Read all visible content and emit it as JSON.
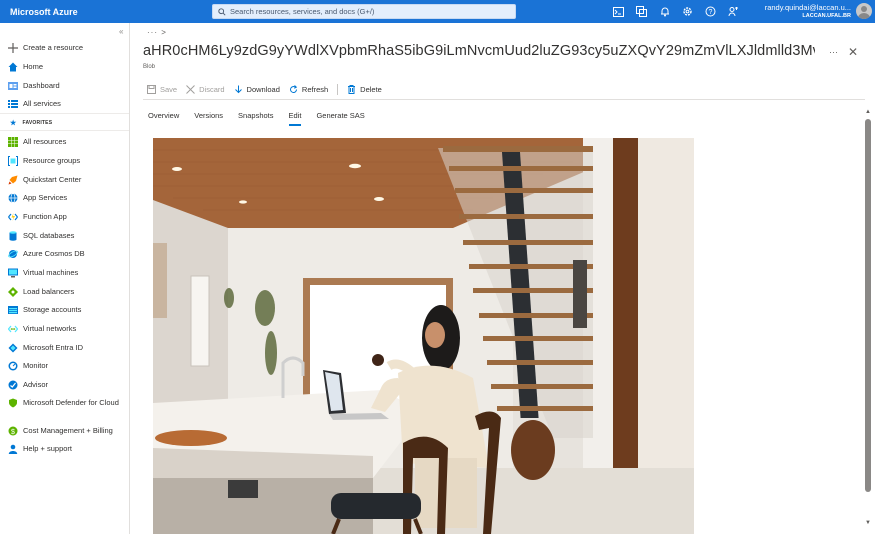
{
  "app": {
    "brand": "Microsoft Azure"
  },
  "search": {
    "placeholder": "Search resources, services, and docs (G+/)"
  },
  "user": {
    "name": "randy.quindai@laccan.u...",
    "tenant": "LACCAN.UFAL.BR"
  },
  "sidebar": {
    "top_items": [
      {
        "label": "Create a resource",
        "icon": "plus-icon"
      },
      {
        "label": "Home",
        "icon": "home-icon"
      },
      {
        "label": "Dashboard",
        "icon": "dashboard-icon"
      },
      {
        "label": "All services",
        "icon": "list-icon"
      }
    ],
    "favorites_label": "FAVORITES",
    "favorites": [
      {
        "label": "All resources",
        "icon": "grid-icon"
      },
      {
        "label": "Resource groups",
        "icon": "resource-group-icon"
      },
      {
        "label": "Quickstart Center",
        "icon": "rocket-icon"
      },
      {
        "label": "App Services",
        "icon": "globe-icon"
      },
      {
        "label": "Function App",
        "icon": "function-icon"
      },
      {
        "label": "SQL databases",
        "icon": "database-icon"
      },
      {
        "label": "Azure Cosmos DB",
        "icon": "cosmos-icon"
      },
      {
        "label": "Virtual machines",
        "icon": "monitor-icon"
      },
      {
        "label": "Load balancers",
        "icon": "balancer-icon"
      },
      {
        "label": "Storage accounts",
        "icon": "storage-icon"
      },
      {
        "label": "Virtual networks",
        "icon": "network-icon"
      },
      {
        "label": "Microsoft Entra ID",
        "icon": "entra-icon"
      },
      {
        "label": "Monitor",
        "icon": "gauge-icon"
      },
      {
        "label": "Advisor",
        "icon": "advisor-icon"
      },
      {
        "label": "Microsoft Defender for Cloud",
        "icon": "shield-icon"
      },
      {
        "label": "Cost Management + Billing",
        "icon": "cost-icon"
      },
      {
        "label": "Help + support",
        "icon": "person-help-icon"
      }
    ]
  },
  "main": {
    "breadcrumb": "··· >",
    "title": "aHR0cHM6Ly9zdG9yYWdlXVpbmRhaS5ibG9iLmNvcmUud2luZG93cy5uZXQvY29mZmVlLXJldmlld3Mvc...",
    "subtitle": "Blob",
    "more": "···",
    "close": "✕",
    "toolbar": {
      "save": "Save",
      "discard": "Discard",
      "download": "Download",
      "refresh": "Refresh",
      "delete": "Delete"
    },
    "tabs": [
      "Overview",
      "Versions",
      "Snapshots",
      "Edit",
      "Generate SAS"
    ],
    "active_tab": "Edit"
  },
  "colors": {
    "topbar": "#1a73d6",
    "accent": "#0078d4"
  }
}
